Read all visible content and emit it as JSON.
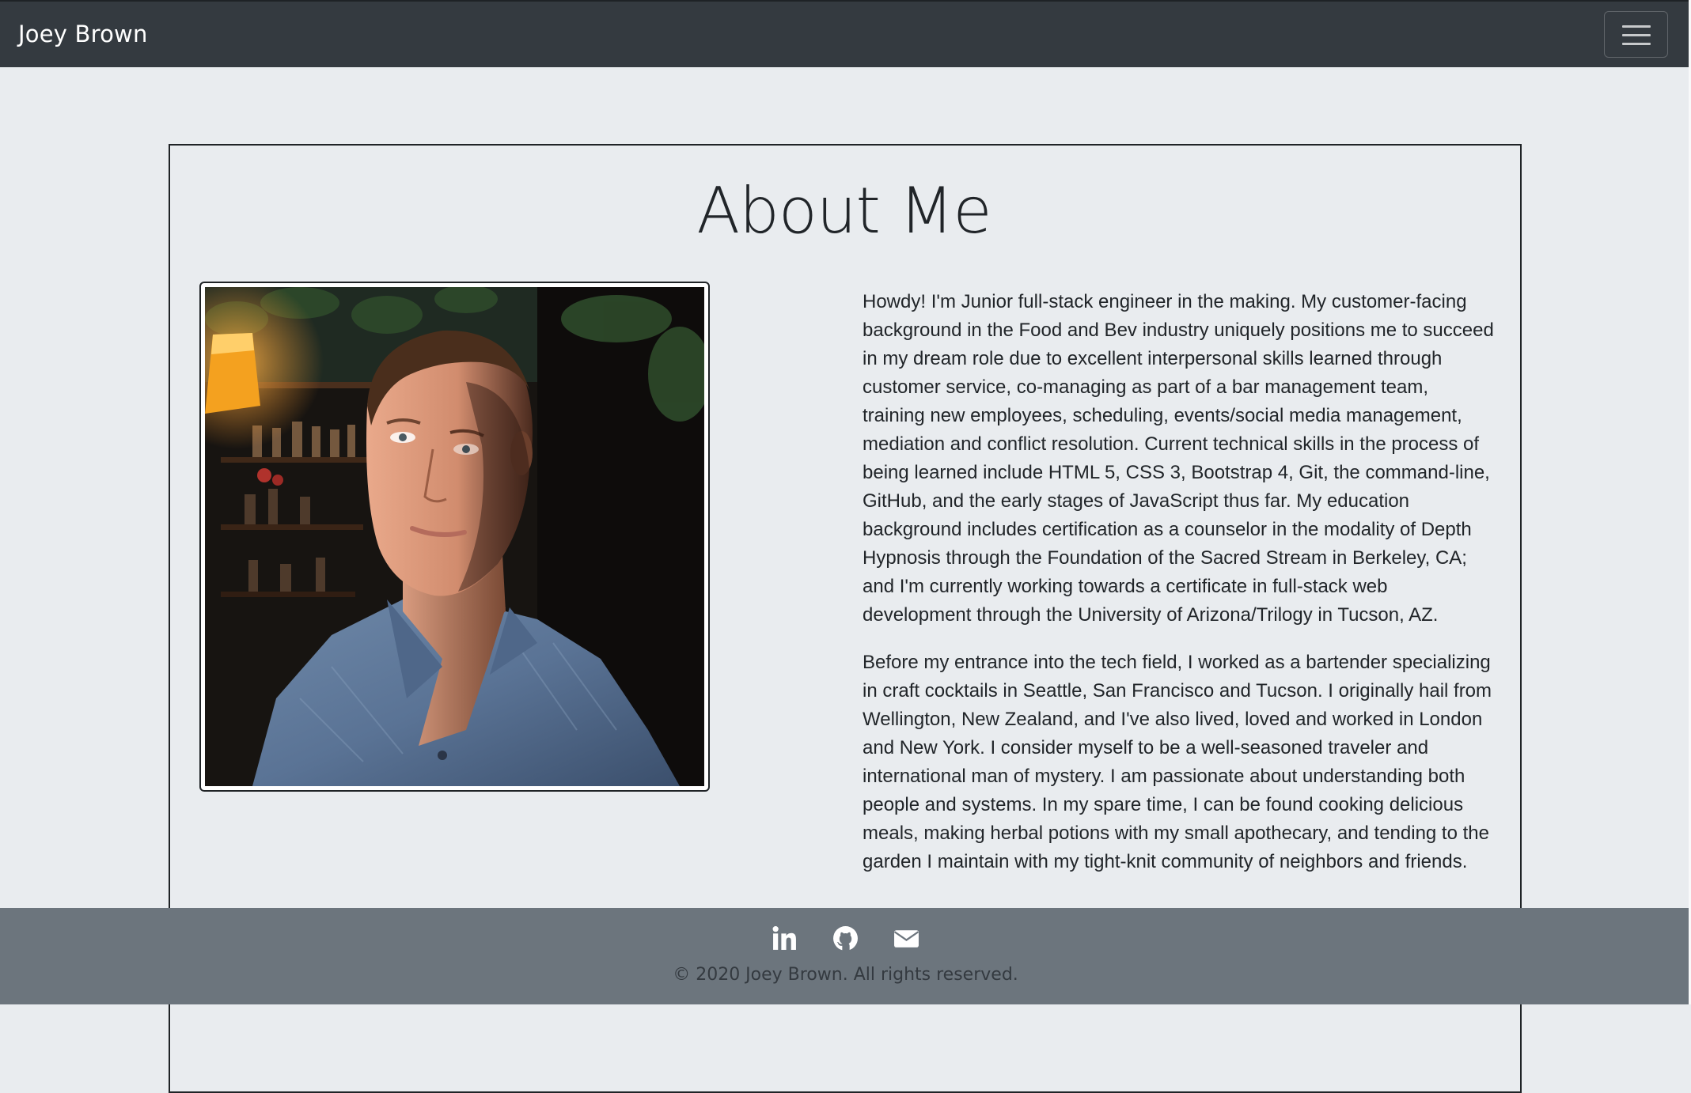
{
  "navbar": {
    "brand": "Joey Brown",
    "toggler_icon": "hamburger-menu-icon"
  },
  "about": {
    "title": "About Me",
    "photo_alt": "Portrait of Joey Brown",
    "paragraphs": [
      "Howdy! I'm Junior full-stack engineer in the making. My customer-facing background in the Food and Bev industry uniquely positions me to succeed in my dream role due to excellent interpersonal skills learned through customer service, co-managing as part of a bar management team, training new employees, scheduling, events/social media management, mediation and conflict resolution. Current technical skills in the process of being learned include HTML 5, CSS 3, Bootstrap 4, Git, the command-line, GitHub, and the early stages of JavaScript thus far. My education background includes certification as a counselor in the modality of Depth Hypnosis through the Foundation of the Sacred Stream in Berkeley, CA; and I'm currently working towards a certificate in full-stack web development through the University of Arizona/Trilogy in Tucson, AZ.",
      "Before my entrance into the tech field, I worked as a bartender specializing in craft cocktails in Seattle, San Francisco and Tucson. I originally hail from Wellington, New Zealand, and I've also lived, loved and worked in London and New York. I consider myself to be a well-seasoned traveler and international man of mystery. I am passionate about understanding both people and systems. In my spare time, I can be found cooking delicious meals, making herbal potions with my small apothecary, and tending to the garden I maintain with my tight-knit community of neighbors and friends."
    ]
  },
  "footer": {
    "icons": [
      "linkedin-icon",
      "github-icon",
      "envelope-icon"
    ],
    "copyright": "© 2020 Joey Brown. All rights reserved."
  }
}
